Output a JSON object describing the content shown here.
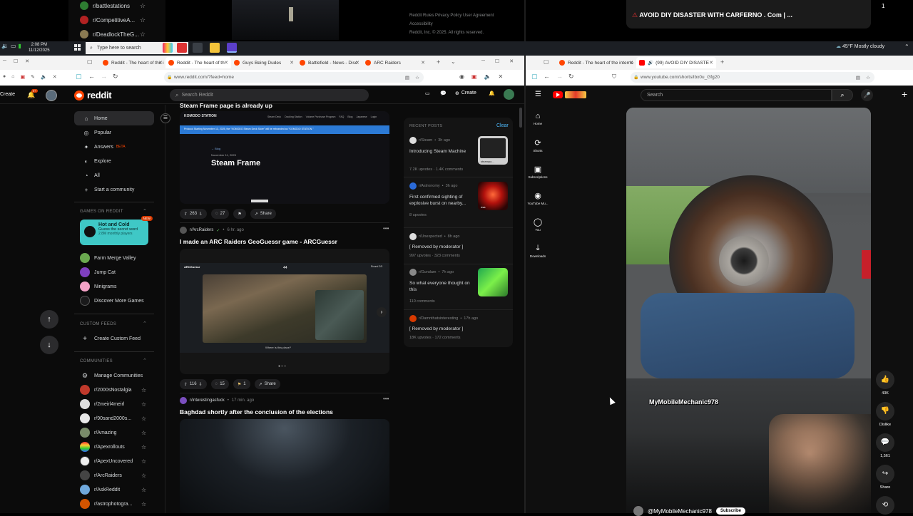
{
  "upper": {
    "subs": [
      "r/battlestations",
      "r/CompetitiveA...",
      "r/DeadlockTheG..."
    ],
    "footer_links": [
      "Reddit Rules  Privacy Policy  User Agreement",
      "Accessibility",
      "Reddit, Inc. © 2025. All rights reserved."
    ],
    "yt_title": "AVOID DIY DISASTER WITH CARFERNO . Com | ...",
    "yt_num": "1"
  },
  "taskbar": {
    "time": "2:08 PM",
    "date": "11/12/2025",
    "search_placeholder": "Type here to search",
    "weather": "45°F  Mostly cloudy"
  },
  "left_browser": {
    "tabs": [
      "Reddit - The heart of the i",
      "Reddit - The heart of th",
      "Guys Being Dudes",
      "Battlefield - News - Disc",
      "ARC Raiders"
    ],
    "url": "www.reddit.com/?feed=home"
  },
  "right_browser": {
    "tabs": [
      "Reddit - The heart of the interne",
      "(99) AVOID DIY DISASTE"
    ],
    "url": "www.youtube.com/shorts/lbx0u_Gfg20"
  },
  "reddit": {
    "create_left": "Create",
    "logo": "reddit",
    "search_placeholder": "Search Reddit",
    "create": "Create",
    "nav": [
      {
        "label": "Home",
        "icon": "⌂"
      },
      {
        "label": "Popular",
        "icon": "◎"
      },
      {
        "label": "Answers",
        "icon": "✦",
        "badge": "BETA"
      },
      {
        "label": "Explore",
        "icon": "◐"
      },
      {
        "label": "All",
        "icon": "◔"
      },
      {
        "label": "Start a community",
        "icon": "+"
      }
    ],
    "games_head": "GAMES ON REDDIT",
    "game_card": {
      "title": "Hot and Cold",
      "sub": "Guess the secret word",
      "players": "2.8M monthly players",
      "badge": "NEW"
    },
    "games": [
      "Farm Merge Valley",
      "Jump Cat",
      "Ninigrams",
      "Discover More Games"
    ],
    "custom_head": "CUSTOM FEEDS",
    "custom_create": "Create Custom Feed",
    "communities_head": "COMMUNITIES",
    "manage": "Manage Communities",
    "communities": [
      "r/2000sNostalgia",
      "r/2meirl4meirl",
      "r/90sand2000s...",
      "r/Amazing",
      "r/Apexrollouts",
      "r/ApexUncovered",
      "r/ArcRaiders",
      "r/AskReddit",
      "r/astrophotogra..."
    ],
    "posts": [
      {
        "title": "Steam Frame page is already up",
        "media_headline": "Steam Frame",
        "media_banner": "Protocol Starting November 13, 2025, the \"KOMODO Steam Deck Store\" will be rebranded as \"KOMODO STATION.\"",
        "media_brand": "KOMODO STATION",
        "media_nav": [
          "Steam Deck",
          "Docking Station",
          "Volume Purchase Program",
          "FAQ",
          "Blog",
          "Japanese",
          "Login"
        ],
        "media_crumb": "← Blog",
        "media_date": "November 11, 2025",
        "votes": "263",
        "comments": "27",
        "share": "Share"
      },
      {
        "sub": "r/ArcRaiders",
        "time": "6 hr. ago",
        "title": "I made an ARC Raiders GeoGuessr game - ARCGuessr",
        "media_logo": "ARCGuessr",
        "media_round": "Round 2/5",
        "media_score": "44",
        "media_caption": "Where is this place?",
        "votes": "116",
        "comments": "15",
        "award": "1",
        "share": "Share"
      },
      {
        "sub": "r/interestingasfuck",
        "time": "17 min. ago",
        "title": "Baghdad shortly after the conclusion of the elections"
      }
    ],
    "recent": {
      "head": "RECENT POSTS",
      "clear": "Clear",
      "items": [
        {
          "sub": "r/Steam",
          "time": "3h ago",
          "title": "Introducing Steam Machine",
          "stats": "7.2K upvotes  ·  1.4K comments",
          "thumb_label": "steampo..."
        },
        {
          "sub": "r/Astronomy",
          "time": "3h ago",
          "title": "First confirmed sighting of explosive burst on nearby...",
          "stats": "8 upvotes",
          "thumb_label": "esa"
        },
        {
          "sub": "r/Unexpected",
          "time": "8h ago",
          "title": "[ Removed by moderator ]",
          "stats": "997 upvotes  ·  323 comments"
        },
        {
          "sub": "r/Gundam",
          "time": "7h ago",
          "title": "So what everyone thought on this",
          "stats": "110 comments"
        },
        {
          "sub": "r/Damnthatsinteresting",
          "time": "17h ago",
          "title": "[ Removed by moderator ]",
          "stats": "18K upvotes  ·  172 comments"
        }
      ]
    }
  },
  "youtube": {
    "search_placeholder": "Search",
    "side": [
      {
        "icon": "⌂",
        "label": "Home"
      },
      {
        "icon": "⟳",
        "label": "Shorts"
      },
      {
        "icon": "▣",
        "label": "Subscriptions"
      },
      {
        "icon": "◉",
        "label": "YouTube Mu..."
      },
      {
        "icon": "◯",
        "label": "You"
      },
      {
        "icon": "⤓",
        "label": "Downloads"
      }
    ],
    "watermark": "MyMobileMechanic978",
    "channel": "@MyMobileMechanic978",
    "subscribe": "Subscribe",
    "actions": [
      {
        "icon": "👍",
        "label": "43K"
      },
      {
        "icon": "👎",
        "label": "Dislike"
      },
      {
        "icon": "💬",
        "label": "1,561"
      },
      {
        "icon": "↪",
        "label": "Share"
      },
      {
        "icon": "⟲",
        "label": ""
      }
    ]
  }
}
